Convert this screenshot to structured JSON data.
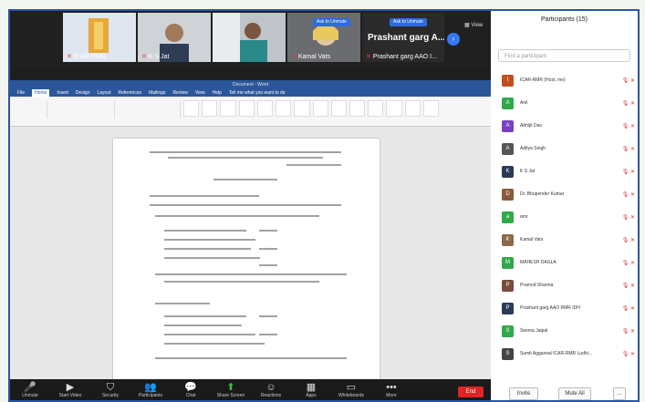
{
  "video_strip": {
    "tiles": [
      {
        "name": "ICAR-RMR"
      },
      {
        "name": "K S Jat"
      },
      {
        "name": ""
      },
      {
        "name": "Kamal Vats"
      },
      {
        "name": "Prashant garg AAO I..."
      }
    ],
    "featured_label": "Prashant garg A...",
    "overlay_buttons": [
      "Ask to Unmute",
      "Ask to Unmute"
    ],
    "view_label": "View"
  },
  "word": {
    "title": "Document - Word",
    "menu": [
      "File",
      "Home",
      "Insert",
      "Design",
      "Layout",
      "References",
      "Mailings",
      "Review",
      "View",
      "Help",
      "Tell me what you want to do"
    ]
  },
  "toolbar": {
    "buttons": [
      {
        "label": "Unmute",
        "icon": "mic-icon"
      },
      {
        "label": "Start Video",
        "icon": "video-icon"
      },
      {
        "label": "Security",
        "icon": "shield-icon"
      },
      {
        "label": "Participants",
        "icon": "people-icon"
      },
      {
        "label": "Chat",
        "icon": "chat-icon"
      },
      {
        "label": "Share Screen",
        "icon": "share-icon"
      },
      {
        "label": "Reactions",
        "icon": "reaction-icon"
      },
      {
        "label": "Apps",
        "icon": "apps-icon"
      },
      {
        "label": "Whiteboards",
        "icon": "whiteboard-icon"
      },
      {
        "label": "More",
        "icon": "more-icon"
      }
    ],
    "end_label": "End"
  },
  "participants": {
    "title": "Participants (15)",
    "search_placeholder": "Find a participant",
    "list": [
      {
        "name": "ICAR-RMR (Host, me)",
        "color": "#c05020"
      },
      {
        "name": "Anil",
        "color": "#2fa94a"
      },
      {
        "name": "Abhijit Das",
        "color": "#7a3fc4"
      },
      {
        "name": "Aditya Singh",
        "color": "#555555"
      },
      {
        "name": "K S Jat",
        "color": "#2b3a55"
      },
      {
        "name": "Dr. Bhupender Kumar",
        "color": "#8a5a3a"
      },
      {
        "name": "amr",
        "color": "#2fa94a"
      },
      {
        "name": "Kamal Vats",
        "color": "#8a6a4a"
      },
      {
        "name": "MAHESH DAGLA",
        "color": "#2fa94a"
      },
      {
        "name": "Pramod Sharma",
        "color": "#7a4a3a"
      },
      {
        "name": "Prashant garg AAO RMR IDH",
        "color": "#2b3a55"
      },
      {
        "name": "Seema Jaipal",
        "color": "#2fa94a"
      },
      {
        "name": "Sumit Aggarwal ICAR-RMR Ludhi...",
        "color": "#444444"
      }
    ],
    "invite_label": "Invite",
    "mute_all_label": "Mute All"
  }
}
